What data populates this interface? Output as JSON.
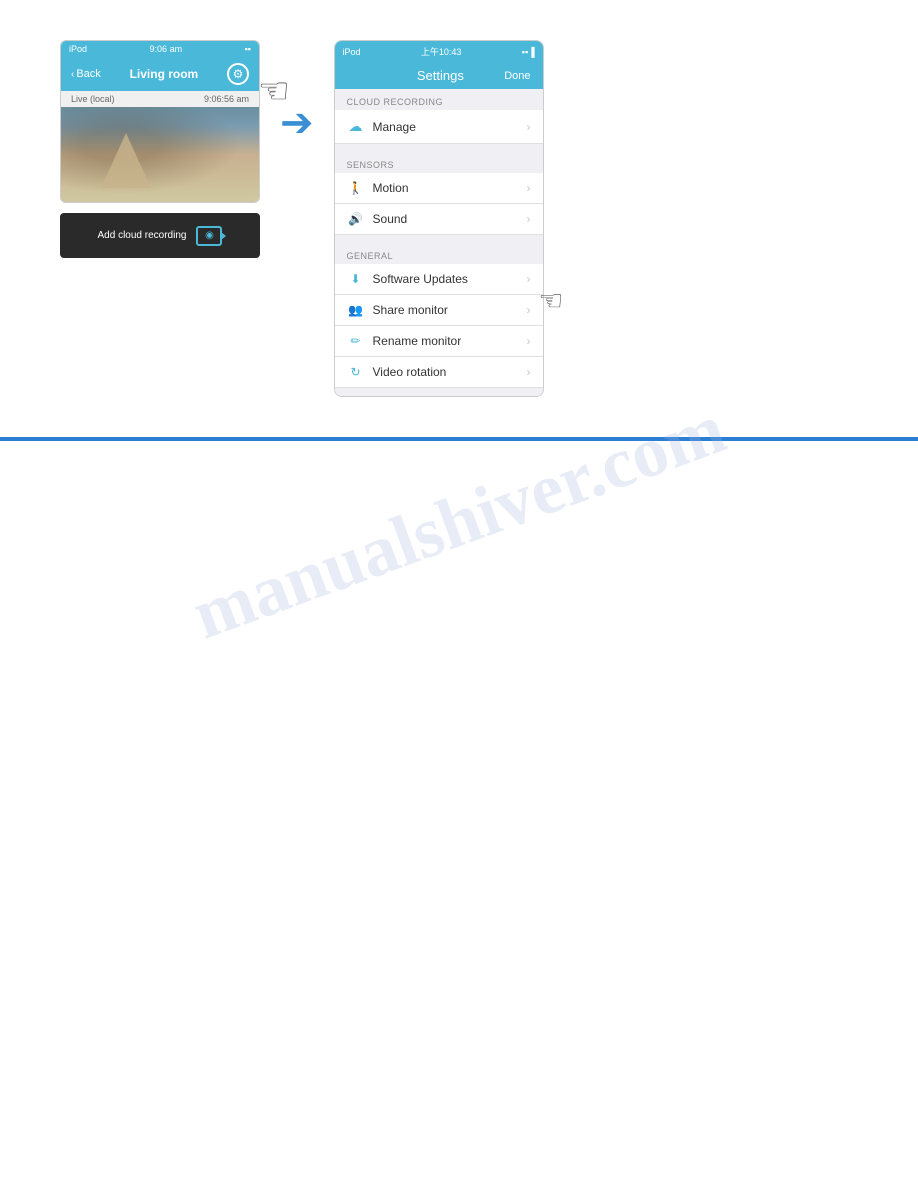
{
  "left_phone": {
    "status_bar": {
      "device": "iPod",
      "signal": "WiFi",
      "time": "9:06 am",
      "battery": "⬜"
    },
    "nav": {
      "back_label": "Back",
      "title": "Living room",
      "gear_icon": "⚙"
    },
    "live_bar": {
      "live_label": "Live (local)",
      "time_label": "9:06:56 am"
    },
    "cloud_bar": {
      "label": "Add cloud recording",
      "camera_icon": "📷"
    }
  },
  "arrow": {
    "icon": "➜"
  },
  "right_phone": {
    "status_bar": {
      "device": "iPod",
      "signal": "WiFi",
      "time": "上午10:43",
      "battery": "⬜"
    },
    "nav": {
      "title": "Settings",
      "done_label": "Done"
    },
    "sections": [
      {
        "header": "CLOUD RECORDING",
        "items": [
          {
            "icon": "☁",
            "label": "Manage"
          }
        ]
      },
      {
        "header": "SENSORS",
        "items": [
          {
            "icon": "🚶",
            "label": "Motion"
          },
          {
            "icon": "🔊",
            "label": "Sound"
          }
        ]
      },
      {
        "header": "GENERAL",
        "items": [
          {
            "icon": "⬇",
            "label": "Software Updates"
          },
          {
            "icon": "👥",
            "label": "Share monitor"
          },
          {
            "icon": "✏",
            "label": "Rename monitor"
          },
          {
            "icon": "↻",
            "label": "Video rotation"
          }
        ]
      }
    ]
  },
  "watermark": {
    "text": "manualshive⁠r.com"
  },
  "divider": {}
}
